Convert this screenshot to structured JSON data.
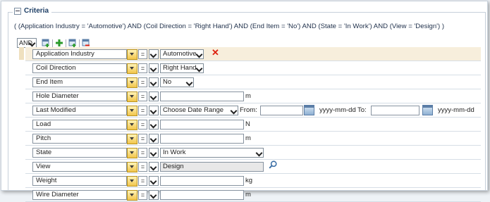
{
  "criteria": {
    "title": "Criteria",
    "summary": "( (Application Industry = 'Automotive') AND (Coil Direction = 'Right Hand') AND (End Item = 'No') AND (State = 'In Work') AND (View = 'Design') )",
    "logic_operator": "AND"
  },
  "toolbar": {
    "icons": [
      "add-row-icon",
      "add-green-icon",
      "add-group-icon",
      "remove-group-icon"
    ]
  },
  "rows": [
    {
      "name": "Application Industry",
      "operator": "=",
      "value": "Automotive"
    },
    {
      "name": "Coil Direction",
      "operator": "=",
      "value": "Right Hand"
    },
    {
      "name": "End Item",
      "operator": "=",
      "value": "No"
    },
    {
      "name": "Hole Diameter",
      "operator": "=",
      "value": "",
      "unit": "m"
    },
    {
      "name": "Last Modified",
      "operator": "=",
      "value": "Choose Date Range",
      "from_label": "From:",
      "to_label": "To:",
      "date_format": "yyyy-mm-dd"
    },
    {
      "name": "Load",
      "operator": "=",
      "value": "",
      "unit": "N"
    },
    {
      "name": "Pitch",
      "operator": "=",
      "value": "",
      "unit": "m"
    },
    {
      "name": "State",
      "operator": "=",
      "value": "In Work"
    },
    {
      "name": "View",
      "operator": "=",
      "value": "Design"
    },
    {
      "name": "Weight",
      "operator": "=",
      "value": "",
      "unit": "kg"
    },
    {
      "name": "Wire Diameter",
      "operator": "=",
      "value": "",
      "unit": "m"
    }
  ],
  "colors": {
    "accent": "#1e3f66",
    "highlight_row": "#f7eedc",
    "dropdown": "#f2c54b",
    "delete": "#dd2211"
  }
}
